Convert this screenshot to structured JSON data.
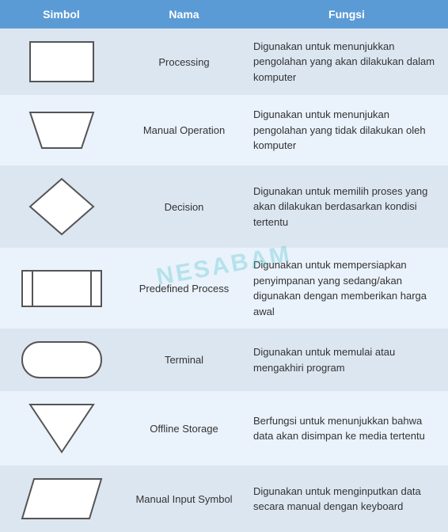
{
  "header": {
    "col1": "Simbol",
    "col2": "Nama",
    "col3": "Fungsi"
  },
  "rows": [
    {
      "nama": "Processing",
      "fungsi": "Digunakan untuk menunjukkan pengolahan yang akan dilakukan dalam komputer",
      "shape": "rectangle"
    },
    {
      "nama": "Manual Operation",
      "fungsi": "Digunakan untuk menunjukan pengolahan yang tidak dilakukan oleh komputer",
      "shape": "trapezoid"
    },
    {
      "nama": "Decision",
      "fungsi": "Digunakan untuk memilih proses yang akan dilakukan berdasarkan kondisi tertentu",
      "shape": "diamond"
    },
    {
      "nama": "Predefined Process",
      "fungsi": "Digunakan untuk mempersiapkan penyimpanan yang sedang/akan digunakan dengan memberikan harga awal",
      "shape": "predefined"
    },
    {
      "nama": "Terminal",
      "fungsi": "Digunakan untuk memulai atau mengakhiri program",
      "shape": "terminal"
    },
    {
      "nama": "Offline Storage",
      "fungsi": "Berfungsi untuk menunjukkan bahwa data akan disimpan ke media tertentu",
      "shape": "triangle-down"
    },
    {
      "nama": "Manual Input Symbol",
      "fungsi": "Digunakan untuk menginputkan data secara manual dengan keyboard",
      "shape": "manual-input"
    }
  ]
}
